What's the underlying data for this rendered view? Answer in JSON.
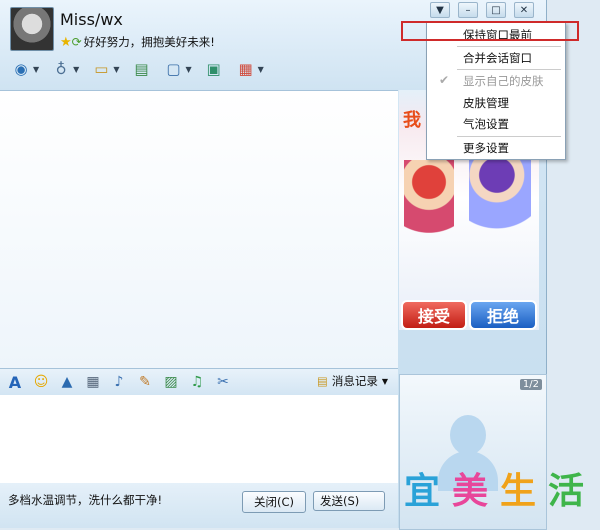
{
  "user": {
    "name": "Miss/wx",
    "signature": "好好努力，拥抱美好未来!"
  },
  "toolbar": {
    "items": [
      {
        "icon": "camera-icon",
        "glyph": "◉"
      },
      {
        "icon": "microphone-icon",
        "glyph": "🎙"
      },
      {
        "icon": "folder-icon",
        "glyph": "🗀"
      },
      {
        "icon": "chat-add-icon",
        "glyph": "✉"
      },
      {
        "icon": "screen-share-icon",
        "glyph": "🖥"
      },
      {
        "icon": "image-icon",
        "glyph": "▣"
      },
      {
        "icon": "apps-icon",
        "glyph": "▦"
      }
    ]
  },
  "context_menu": {
    "items": [
      {
        "label": "保持窗口最前",
        "highlighted": true
      },
      {
        "label": "合并会话窗口"
      },
      {
        "label": "显示自己的皮肤",
        "checked": true,
        "disabled": true
      },
      {
        "label": "皮肤管理"
      },
      {
        "label": "气泡设置"
      },
      {
        "label": "更多设置"
      }
    ]
  },
  "ad": {
    "accept_label": "接受",
    "reject_label": "拒绝",
    "partial_text": "我"
  },
  "video_panel": {
    "page_indicator": "1/2"
  },
  "format_bar": {
    "history_label": "消息记录"
  },
  "bottom": {
    "tip": "多档水温调节，洗什么都干净!",
    "close_label": "关闭(C)",
    "send_label": "发送(S)"
  },
  "watermark": {
    "chars": [
      "宜",
      "美",
      "生",
      "活"
    ],
    "colors": [
      "#2aa2d8",
      "#e8469a",
      "#f0a21a",
      "#3fb54a"
    ]
  }
}
